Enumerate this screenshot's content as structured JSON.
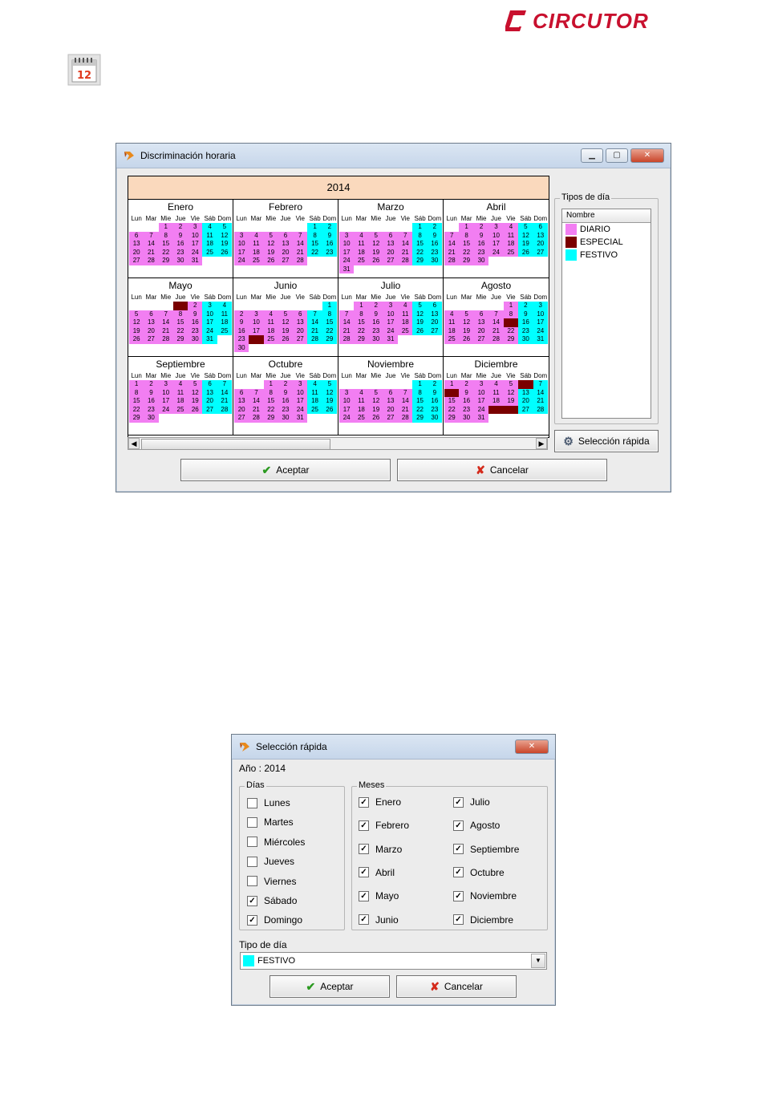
{
  "brand": {
    "name": "CIRCUTOR",
    "color": "#c8102e"
  },
  "page_icon": {
    "icon": "calendar-icon",
    "day": "12"
  },
  "colors": {
    "diario": "#f27ef2",
    "especial": "#7a0000",
    "festivo": "#00ffff"
  },
  "main_window": {
    "title": "Discriminación horaria",
    "year": "2014",
    "weekdays": [
      "Lun",
      "Mar",
      "Mie",
      "Jue",
      "Vie",
      "Sáb",
      "Dom"
    ],
    "months": [
      {
        "name": "Enero",
        "offset": 2,
        "days": 31,
        "special": []
      },
      {
        "name": "Febrero",
        "offset": 5,
        "days": 28,
        "special": []
      },
      {
        "name": "Marzo",
        "offset": 5,
        "days": 31,
        "special": []
      },
      {
        "name": "Abril",
        "offset": 1,
        "days": 30,
        "special": []
      },
      {
        "name": "Mayo",
        "offset": 3,
        "days": 31,
        "special": [
          1
        ]
      },
      {
        "name": "Junio",
        "offset": 6,
        "days": 30,
        "special": [
          24
        ]
      },
      {
        "name": "Julio",
        "offset": 1,
        "days": 31,
        "special": []
      },
      {
        "name": "Agosto",
        "offset": 4,
        "days": 31,
        "special": [
          15
        ]
      },
      {
        "name": "Septiembre",
        "offset": 0,
        "days": 30,
        "special": []
      },
      {
        "name": "Octubre",
        "offset": 2,
        "days": 31,
        "special": []
      },
      {
        "name": "Noviembre",
        "offset": 5,
        "days": 30,
        "special": []
      },
      {
        "name": "Diciembre",
        "offset": 0,
        "days": 31,
        "special": [
          6,
          8,
          25,
          26
        ]
      }
    ],
    "tipos_label": "Tipos de día",
    "list_header": "Nombre",
    "tipos": [
      {
        "name": "DIARIO",
        "color": "#f27ef2"
      },
      {
        "name": "ESPECIAL",
        "color": "#7a0000"
      },
      {
        "name": "FESTIVO",
        "color": "#00ffff"
      }
    ],
    "quick_button": "Selección rápida",
    "accept": "Aceptar",
    "cancel": "Cancelar"
  },
  "quick_dialog": {
    "title": "Selección rápida",
    "year_label": "Año : 2014",
    "days_label": "Días",
    "days": [
      {
        "label": "Lunes",
        "checked": false
      },
      {
        "label": "Martes",
        "checked": false
      },
      {
        "label": "Miércoles",
        "checked": false
      },
      {
        "label": "Jueves",
        "checked": false
      },
      {
        "label": "Viernes",
        "checked": false
      },
      {
        "label": "Sábado",
        "checked": true
      },
      {
        "label": "Domingo",
        "checked": true
      }
    ],
    "months_label": "Meses",
    "months": [
      {
        "label": "Enero",
        "checked": true
      },
      {
        "label": "Febrero",
        "checked": true
      },
      {
        "label": "Marzo",
        "checked": true
      },
      {
        "label": "Abril",
        "checked": true
      },
      {
        "label": "Mayo",
        "checked": true
      },
      {
        "label": "Junio",
        "checked": true
      },
      {
        "label": "Julio",
        "checked": true
      },
      {
        "label": "Agosto",
        "checked": true
      },
      {
        "label": "Septiembre",
        "checked": true
      },
      {
        "label": "Octubre",
        "checked": true
      },
      {
        "label": "Noviembre",
        "checked": true
      },
      {
        "label": "Diciembre",
        "checked": true
      }
    ],
    "tipo_label": "Tipo de día",
    "tipo_value": "FESTIVO",
    "tipo_color": "#00ffff",
    "accept": "Aceptar",
    "cancel": "Cancelar"
  }
}
